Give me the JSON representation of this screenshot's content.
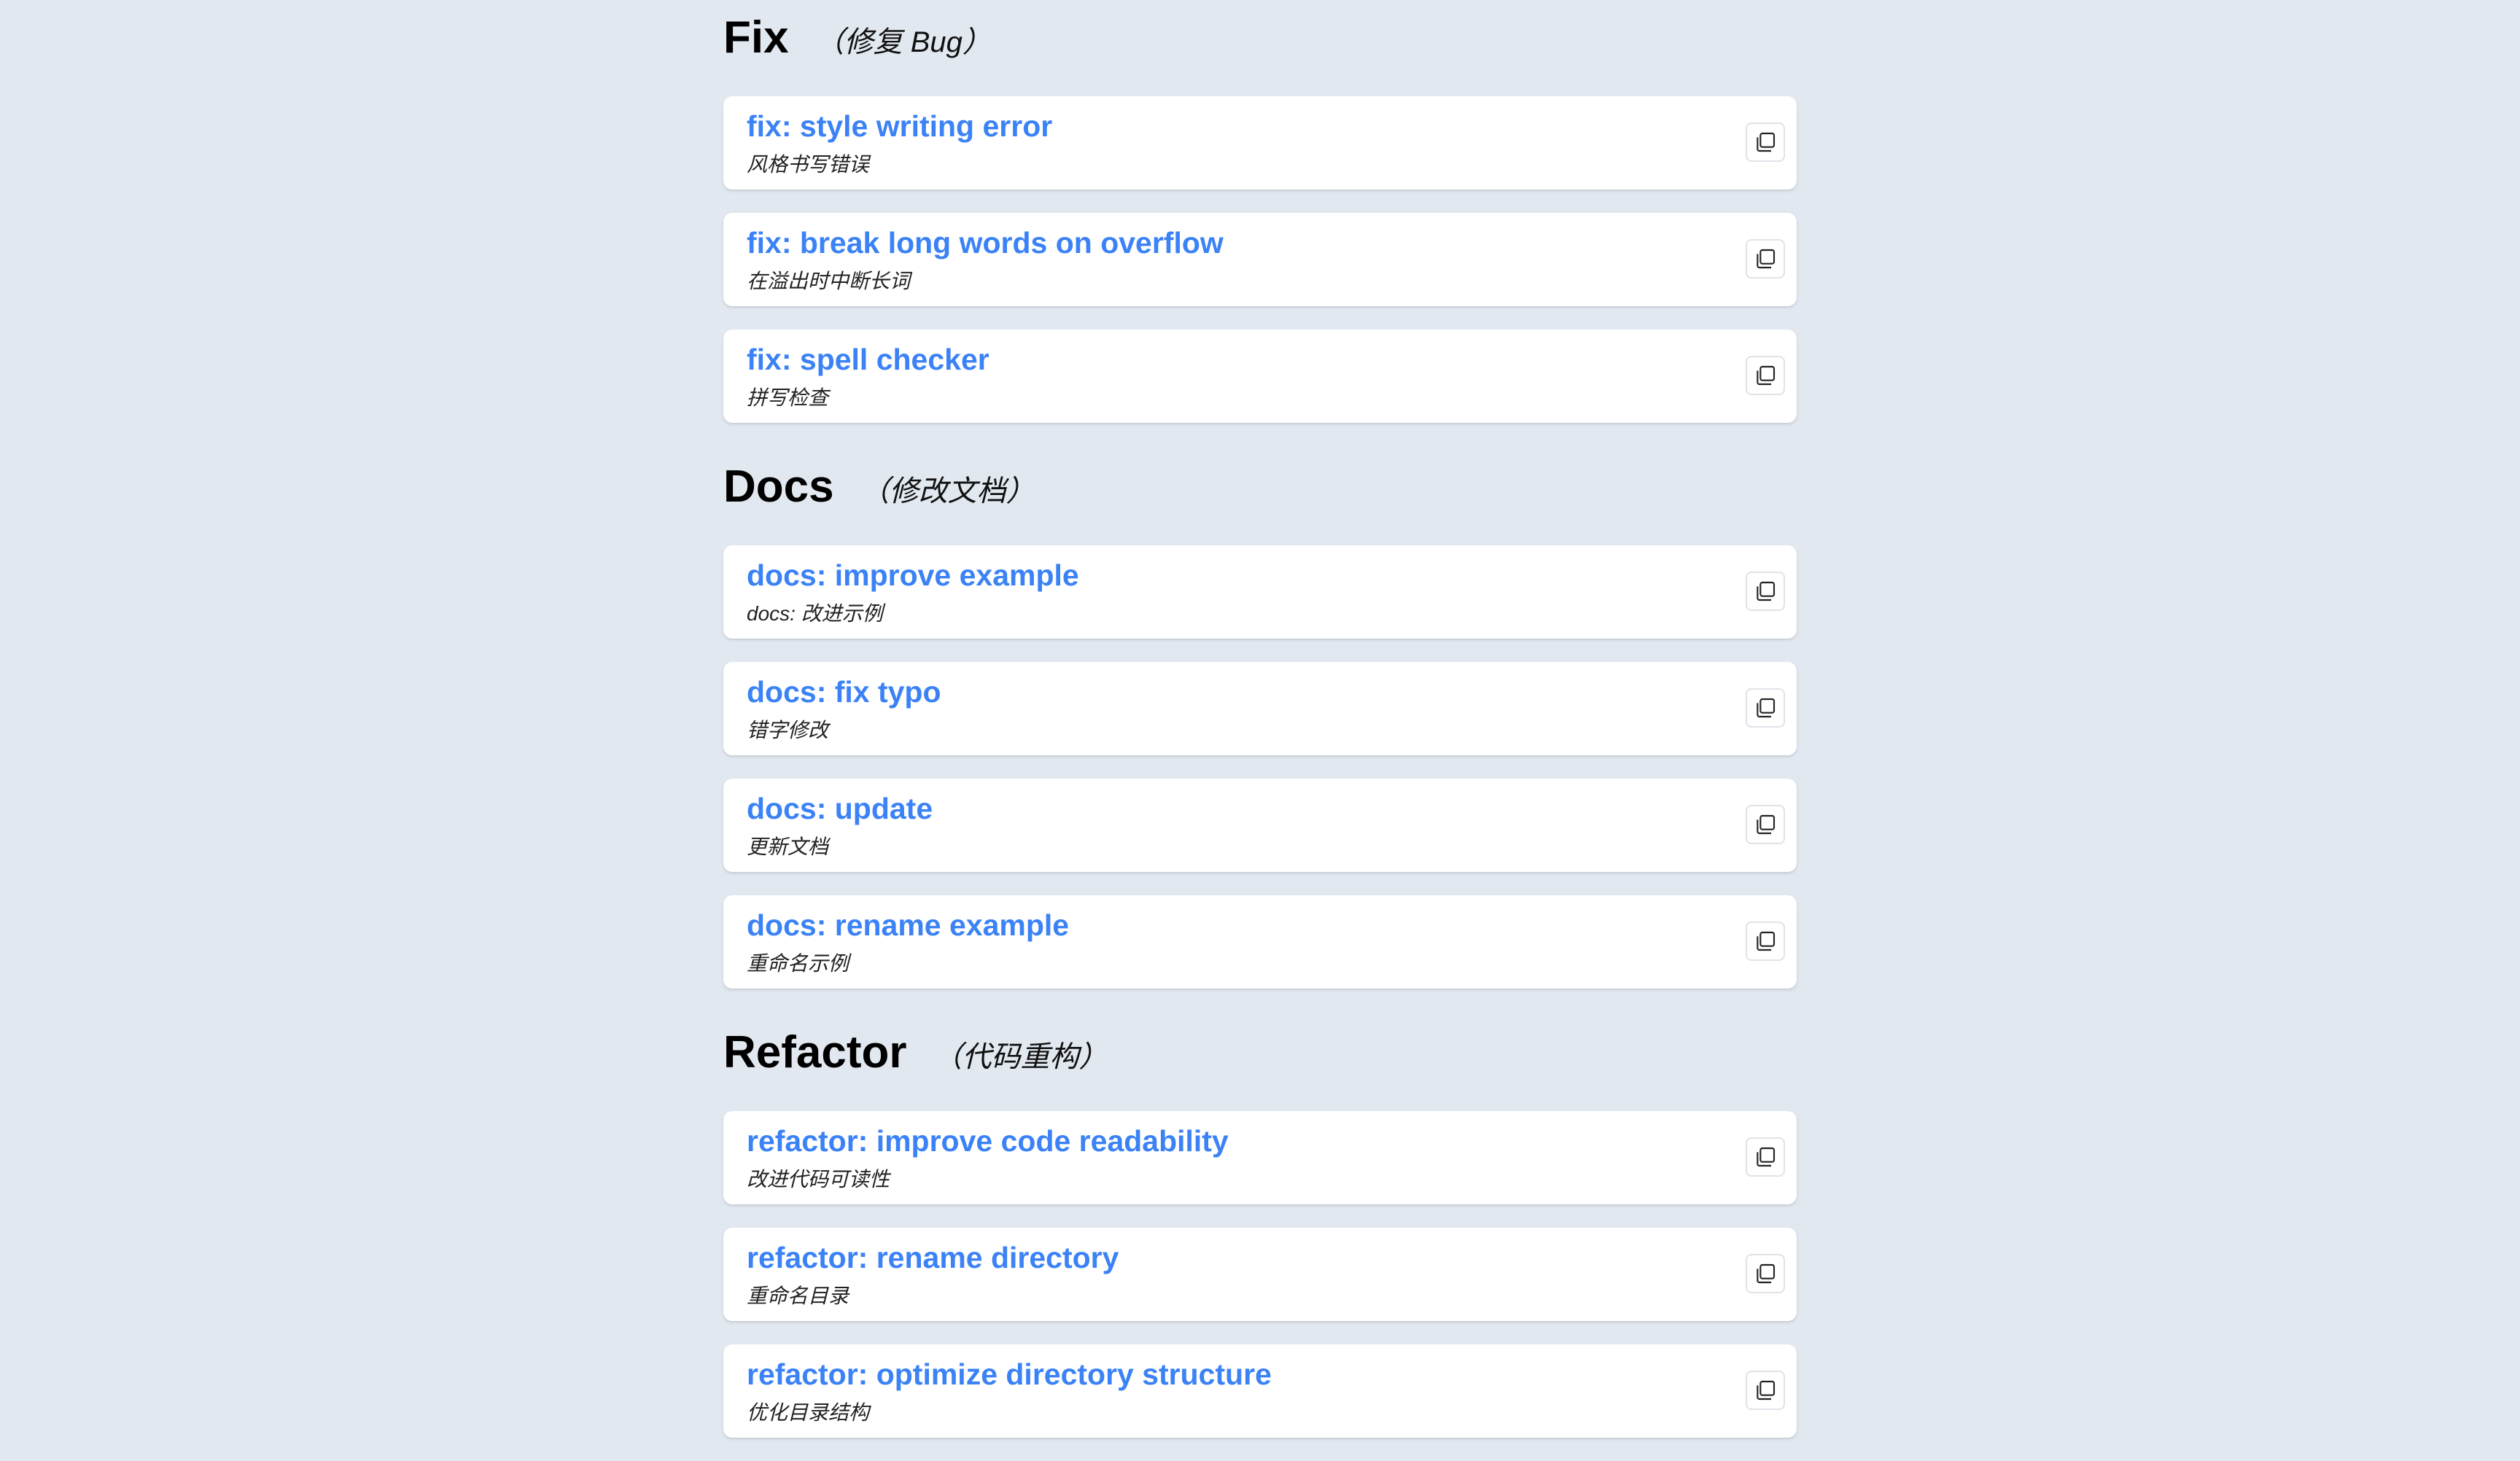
{
  "sections": [
    {
      "title": "Fix",
      "subtitle": "（修复 Bug）",
      "items": [
        {
          "title": "fix: style writing error",
          "desc": "风格书写错误"
        },
        {
          "title": "fix: break long words on overflow",
          "desc": "在溢出时中断长词"
        },
        {
          "title": "fix: spell checker",
          "desc": "拼写检查"
        }
      ]
    },
    {
      "title": "Docs",
      "subtitle": "（修改文档）",
      "items": [
        {
          "title": "docs: improve example",
          "desc": "docs: 改进示例"
        },
        {
          "title": "docs: fix typo",
          "desc": "错字修改"
        },
        {
          "title": "docs: update",
          "desc": "更新文档"
        },
        {
          "title": "docs: rename example",
          "desc": "重命名示例"
        }
      ]
    },
    {
      "title": "Refactor",
      "subtitle": "（代码重构）",
      "items": [
        {
          "title": "refactor: improve code readability",
          "desc": "改进代码可读性"
        },
        {
          "title": "refactor: rename directory",
          "desc": "重命名目录"
        },
        {
          "title": "refactor: optimize directory structure",
          "desc": "优化目录结构"
        }
      ]
    }
  ],
  "icons": {
    "copy": "copy-icon"
  },
  "colors": {
    "background": "#e2e8f0",
    "accent": "#3b82f6",
    "card": "#ffffff"
  }
}
